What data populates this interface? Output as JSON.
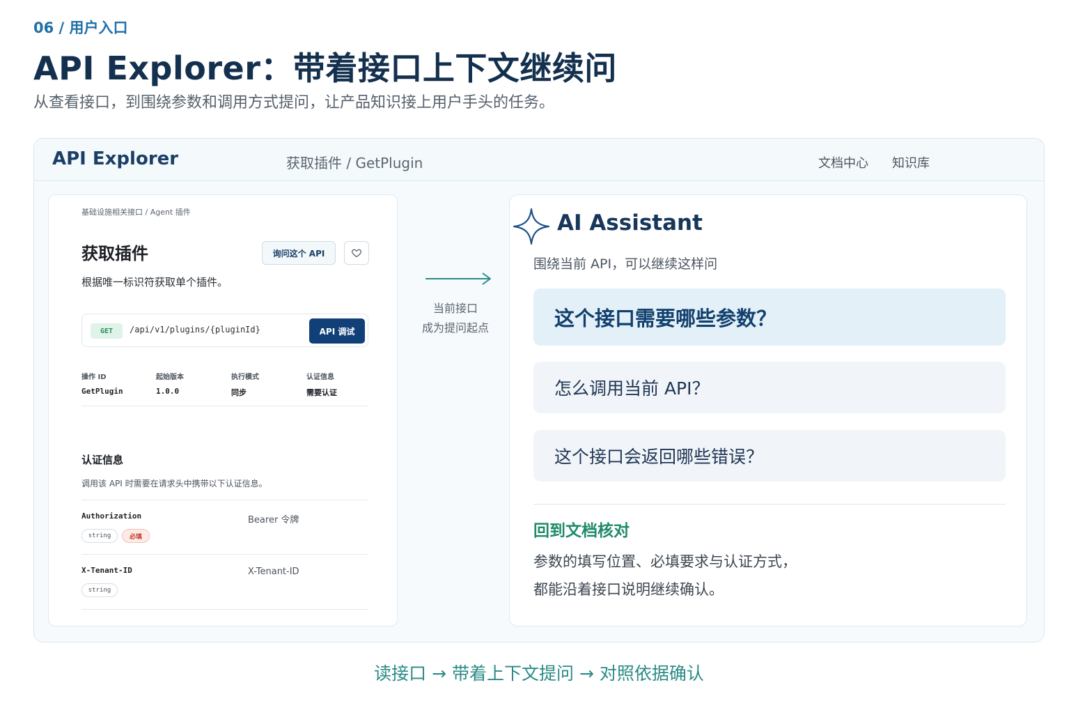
{
  "page": {
    "eyebrow": "06 / 用户入口",
    "title": "API Explorer：带着接口上下文继续问",
    "subtitle": "从查看接口，到围绕参数和调用方式提问，让产品知识接上用户手头的任务。",
    "footer": "读接口 → 带着上下文提问 → 对照依据确认"
  },
  "header": {
    "brand": "API Explorer",
    "breadcrumb": "获取插件 / GetPlugin",
    "links": [
      "文档中心",
      "知识库"
    ]
  },
  "doc": {
    "breadcrumb": "基础设施相关接口  /  Agent  插件",
    "title": "获取插件",
    "ask_button": "询问这个 API",
    "description": "根据唯一标识符获取单个插件。",
    "endpoint": {
      "method": "GET",
      "path": "/api/v1/plugins/{pluginId}",
      "try_button": "API 调试"
    },
    "meta": [
      {
        "label": "操作 ID",
        "value": "GetPlugin"
      },
      {
        "label": "起始版本",
        "value": "1.0.0"
      },
      {
        "label": "执行模式",
        "value": "同步"
      },
      {
        "label": "认证信息",
        "value": "需要认证"
      }
    ],
    "auth": {
      "title": "认证信息",
      "description": "调用该 API 时需要在请求头中携带以下认证信息。",
      "params": [
        {
          "name": "Authorization",
          "value": "Bearer 令牌",
          "type": "string",
          "required": "必填"
        },
        {
          "name": "X-Tenant-ID",
          "value": "X-Tenant-ID",
          "type": "string"
        }
      ]
    }
  },
  "connector": {
    "line1": "当前接口",
    "line2": "成为提问起点",
    "color": "#2a8a86"
  },
  "assistant": {
    "title": "AI Assistant",
    "subtitle": "围绕当前 API，可以继续这样问",
    "questions": [
      "这个接口需要哪些参数？",
      "怎么调用当前 API？",
      "这个接口会返回哪些错误？"
    ],
    "back_title": "回到文档核对",
    "back_desc_line1": "参数的填写位置、必填要求与认证方式，",
    "back_desc_line2": "都能沿着接口说明继续确认。"
  },
  "colors": {
    "brand": "#14304f",
    "accent": "#1f6fa8",
    "primary_button": "#113f78",
    "highlight": "#e3f0f8",
    "green": "#1f8a6a"
  },
  "icons": {
    "favorite": "heart-icon",
    "assistant": "sparkle-star-icon",
    "connector": "arrow-right-icon"
  }
}
